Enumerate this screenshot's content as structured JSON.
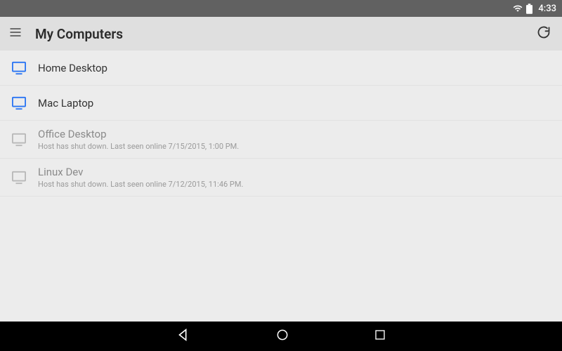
{
  "status": {
    "time": "4:33"
  },
  "header": {
    "title": "My Computers",
    "menu_icon": "menu-icon",
    "refresh_icon": "refresh-icon"
  },
  "colors": {
    "online": "#2a75f3",
    "offline": "#b8b8b8"
  },
  "computers": [
    {
      "name": "Home Desktop",
      "online": true,
      "status": null
    },
    {
      "name": "Mac Laptop",
      "online": true,
      "status": null
    },
    {
      "name": "Office Desktop",
      "online": false,
      "status": "Host has shut down. Last seen online 7/15/2015, 1:00 PM."
    },
    {
      "name": "Linux Dev",
      "online": false,
      "status": "Host has shut down. Last seen online 7/12/2015, 11:46 PM."
    }
  ],
  "nav": {
    "back": "back",
    "home": "home",
    "recent": "recent"
  }
}
